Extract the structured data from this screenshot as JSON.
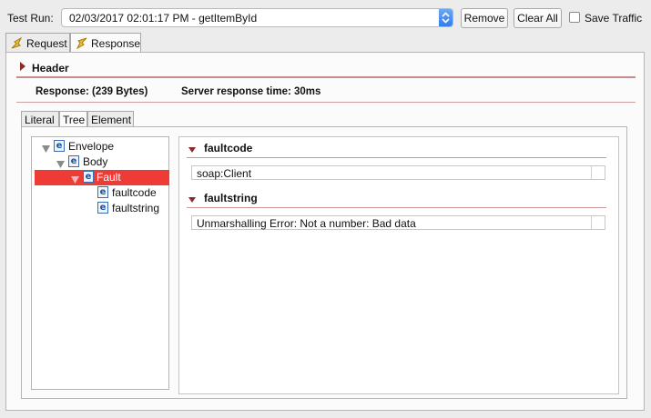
{
  "toolbar": {
    "test_run_label": "Test Run:",
    "test_run_value": "02/03/2017 02:01:17 PM - getItemById",
    "remove_label": "Remove",
    "clear_all_label": "Clear All",
    "save_traffic_label": "Save Traffic",
    "save_traffic_checked": false
  },
  "tabs": {
    "request": "Request",
    "response": "Response"
  },
  "header_section": {
    "title": "Header",
    "response_size": "Response:  (239 Bytes)",
    "server_time": "Server response time: 30ms"
  },
  "view_tabs": {
    "literal": "Literal",
    "tree": "Tree",
    "element": "Element"
  },
  "tree": {
    "envelope": "Envelope",
    "body": "Body",
    "fault": "Fault",
    "faultcode": "faultcode",
    "faultstring": "faultstring",
    "element_badge": "e"
  },
  "details": {
    "faultcode_title": "faultcode",
    "faultcode_value": "soap:Client",
    "faultstring_title": "faultstring",
    "faultstring_value": "Unmarshalling Error: Not a number: Bad data"
  },
  "colors": {
    "selection": "#ef3b35",
    "accent_line": "#9b3030",
    "select_arrow": "#2f7ef0"
  }
}
